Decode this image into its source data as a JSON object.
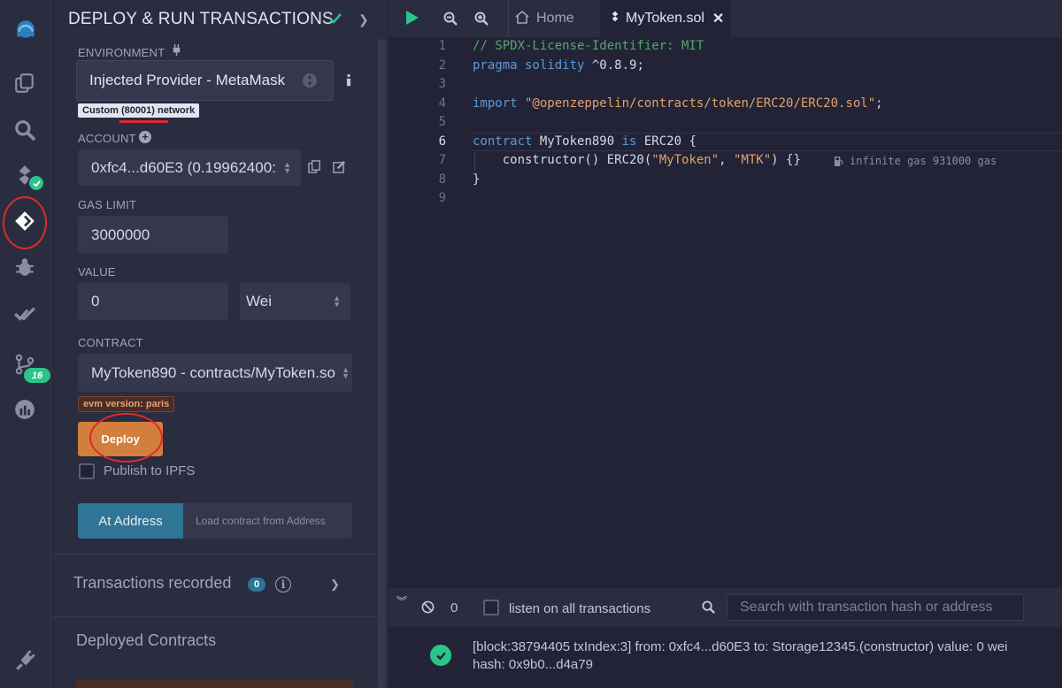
{
  "panel": {
    "title": "DEPLOY & RUN TRANSACTIONS",
    "environment": {
      "label": "ENVIRONMENT",
      "value": "Injected Provider - MetaMask",
      "network_tag": "Custom (80001) network"
    },
    "account": {
      "label": "ACCOUNT",
      "value": "0xfc4...d60E3 (0.19962400:"
    },
    "gas_limit": {
      "label": "GAS LIMIT",
      "value": "3000000"
    },
    "value": {
      "label": "VALUE",
      "amount": "0",
      "unit": "Wei"
    },
    "contract": {
      "label": "CONTRACT",
      "value": "MyToken890 - contracts/MyToken.so",
      "evm_tag": "evm version: paris"
    },
    "deploy_label": "Deploy",
    "publish_ipfs_label": "Publish to IPFS",
    "at_address_label": "At Address",
    "load_address_placeholder": "Load contract from Address",
    "transactions_recorded_label": "Transactions recorded",
    "transactions_recorded_count": "0",
    "deployed_contracts_label": "Deployed Contracts"
  },
  "tabs": {
    "home_label": "Home",
    "file_label": "MyToken.sol"
  },
  "editor": {
    "line_numbers": [
      "1",
      "2",
      "3",
      "4",
      "5",
      "6",
      "7",
      "8",
      "9"
    ],
    "line1": "// SPDX-License-Identifier: MIT",
    "line2_kw": "pragma solidity",
    "line2_rest": " ^0.8.9;",
    "line4_kw": "import",
    "line4_str": " \"@openzeppelin/contracts/token/ERC20/ERC20.sol\"",
    "line4_end": ";",
    "line6_kw": "contract",
    "line6_name": " MyToken890 ",
    "line6_kw2": "is",
    "line6_rest": " ERC20 {",
    "line7_a": "    constructor() ERC20(",
    "line7_s1": "\"MyToken\"",
    "line7_b": ", ",
    "line7_s2": "\"MTK\"",
    "line7_c": ") {}",
    "gas_hint": "infinite gas 931000 gas",
    "line8": "}"
  },
  "terminal": {
    "count": "0",
    "listen_label": "listen on all transactions",
    "search_placeholder": "Search with transaction hash or address",
    "log_line1": "[block:38794405 txIndex:3]   from: 0xfc4...d60E3 to: Storage12345.(constructor) value: 0 wei",
    "log_line2": "hash: 0x9b0...d4a79"
  },
  "colors": {
    "accent_green": "#2bc48a",
    "deploy_orange": "#d27e3c",
    "at_address_blue": "#2e7596",
    "annotation_red": "#e0282a"
  }
}
